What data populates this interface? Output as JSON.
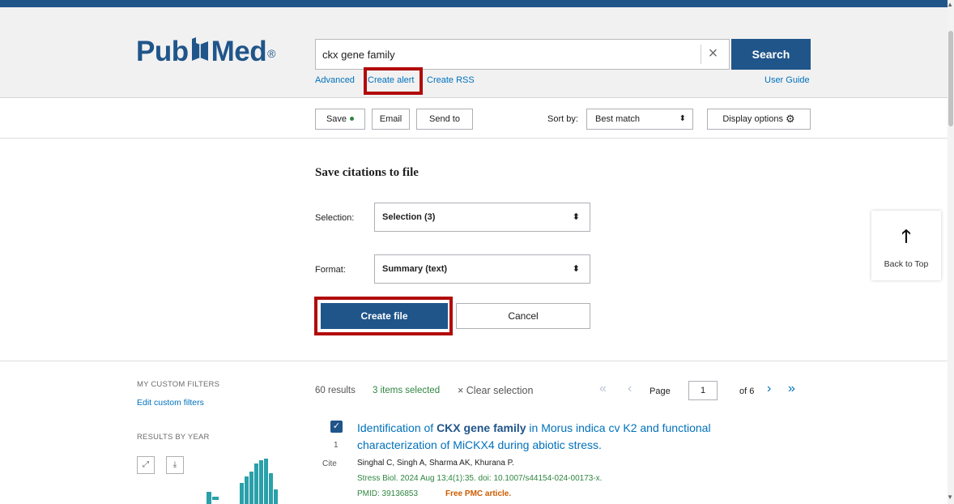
{
  "header": {
    "logo_text_left": "Pub",
    "logo_text_right": "Med",
    "logo_reg": "®",
    "search_value": "ckx gene family",
    "search_button": "Search",
    "links": {
      "advanced": "Advanced",
      "create_alert": "Create alert",
      "create_rss": "Create RSS",
      "user_guide": "User Guide"
    }
  },
  "toolbar": {
    "save": "Save",
    "email": "Email",
    "send_to": "Send to",
    "sort_by_label": "Sort by:",
    "sort_by_value": "Best match",
    "display_options": "Display options"
  },
  "save_panel": {
    "title": "Save citations to file",
    "selection_label": "Selection:",
    "selection_value": "Selection (3)",
    "format_label": "Format:",
    "format_value": "Summary (text)",
    "create_button": "Create file",
    "cancel_button": "Cancel"
  },
  "back_to_top": {
    "label": "Back to Top"
  },
  "sidebar": {
    "my_custom_filters": "MY CUSTOM FILTERS",
    "edit_custom_filters": "Edit custom filters",
    "results_by_year": "RESULTS BY YEAR"
  },
  "results": {
    "count": "60 results",
    "selected": "3 items selected",
    "clear_selection": "× Clear selection",
    "page_label": "Page",
    "page_value": "1",
    "page_of": "of 6"
  },
  "article": {
    "number": "1",
    "cite": "Cite",
    "title_prefix": "Identification of ",
    "title_highlight": "CKX gene family",
    "title_suffix": " in Morus indica cv K2 and functional characterization of MiCKX4 during abiotic stress.",
    "authors": "Singhal C, Singh A, Sharma AK, Khurana P.",
    "citation": "Stress Biol. 2024 Aug 13;4(1):35. doi: 10.1007/s44154-024-00173-x.",
    "pmid": "PMID: 39136853",
    "free_pmc": "Free PMC article."
  },
  "colors": {
    "brand_blue": "#20558a",
    "link_blue": "#0071bc",
    "highlight_red": "#b20a0a",
    "bar_teal": "#2aa0aa",
    "green": "#2e8540",
    "orange": "#cd5c00"
  },
  "icons": [
    "book-icon",
    "clear-icon",
    "gear-icon",
    "sort-arrows-icon",
    "arrow-up-icon",
    "expand-icon",
    "download-icon",
    "first-page-icon",
    "prev-page-icon",
    "next-page-icon",
    "last-page-icon",
    "checkbox-checked-icon"
  ]
}
